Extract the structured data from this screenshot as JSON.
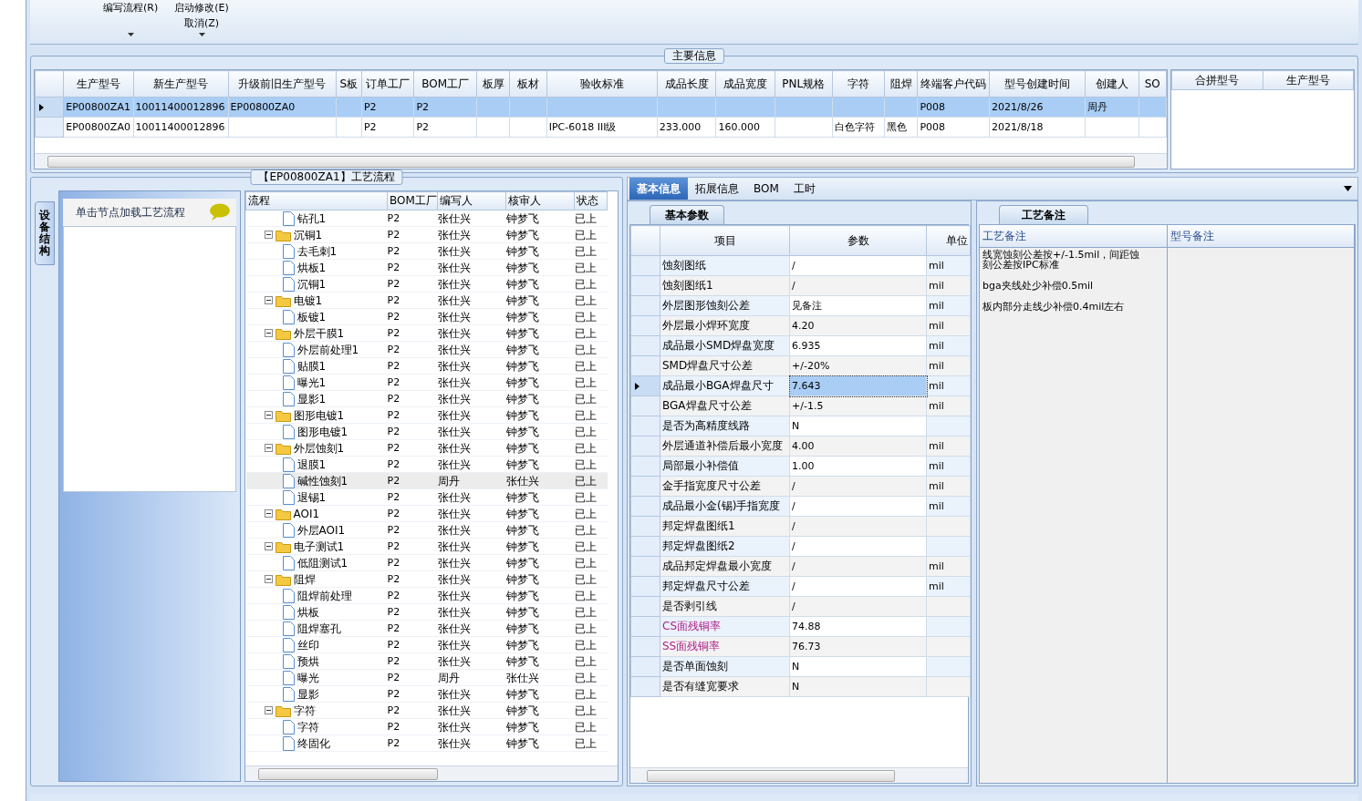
{
  "ribbon": {
    "commands": [
      {
        "label": "编写流程(R)"
      },
      {
        "label": "启动修改(E)"
      },
      {
        "label": "取消(Z)"
      }
    ]
  },
  "main_info": {
    "title": "主要信息",
    "columns": [
      "生产型号",
      "新生产型号",
      "升级前旧生产型号",
      "S板",
      "订单工厂",
      "BOM工厂",
      "板厚",
      "板材",
      "验收标准",
      "成品长度",
      "成品宽度",
      "PNL规格",
      "字符",
      "阻焊",
      "终端客户代码",
      "型号创建时间",
      "创建人",
      "SO"
    ],
    "rows": [
      {
        "selected": true,
        "cells": [
          "EP00800ZA1",
          "10011400012896",
          "EP00800ZA0",
          null,
          "P2",
          "P2",
          null,
          null,
          null,
          null,
          null,
          null,
          null,
          null,
          "P008",
          "2021/8/26",
          "周丹",
          null
        ]
      },
      {
        "selected": false,
        "cells": [
          "EP00800ZA0",
          "10011400012896",
          null,
          null,
          "P2",
          "P2",
          null,
          null,
          "IPC-6018 III级",
          "233.000",
          "160.000",
          null,
          "白色字符",
          "黑色",
          "P008",
          "2021/8/18",
          null,
          null
        ]
      }
    ],
    "side_columns": [
      "合拼型号",
      "生产型号"
    ]
  },
  "process": {
    "title": "【EP00800ZA1】工艺流程",
    "side_tab": "设备结构",
    "hint": "单击节点加载工艺流程",
    "columns": [
      "流程",
      "BOM工厂",
      "编写人",
      "核审人",
      "状态"
    ],
    "tree": [
      {
        "kind": "leaf",
        "name": "钻孔1",
        "bom": "P2",
        "writer": "张仕兴",
        "reviewer": "钟梦飞",
        "status": "已上",
        "selected": false
      },
      {
        "kind": "folder",
        "name": "沉铜1",
        "bom": "P2",
        "writer": "张仕兴",
        "reviewer": "钟梦飞",
        "status": "已上",
        "selected": false,
        "expanded": true,
        "children": [
          {
            "kind": "leaf",
            "name": "去毛刺1",
            "bom": "P2",
            "writer": "张仕兴",
            "reviewer": "钟梦飞",
            "status": "已上",
            "selected": false
          },
          {
            "kind": "leaf",
            "name": "烘板1",
            "bom": "P2",
            "writer": "张仕兴",
            "reviewer": "钟梦飞",
            "status": "已上",
            "selected": false
          },
          {
            "kind": "leaf",
            "name": "沉铜1",
            "bom": "P2",
            "writer": "张仕兴",
            "reviewer": "钟梦飞",
            "status": "已上",
            "selected": false
          }
        ]
      },
      {
        "kind": "folder",
        "name": "电镀1",
        "bom": "P2",
        "writer": "张仕兴",
        "reviewer": "钟梦飞",
        "status": "已上",
        "selected": false,
        "expanded": true,
        "children": [
          {
            "kind": "leaf",
            "name": "板镀1",
            "bom": "P2",
            "writer": "张仕兴",
            "reviewer": "钟梦飞",
            "status": "已上",
            "selected": false
          }
        ]
      },
      {
        "kind": "folder",
        "name": "外层干膜1",
        "bom": "P2",
        "writer": "张仕兴",
        "reviewer": "钟梦飞",
        "status": "已上",
        "selected": false,
        "expanded": true,
        "children": [
          {
            "kind": "leaf",
            "name": "外层前处理1",
            "bom": "P2",
            "writer": "张仕兴",
            "reviewer": "钟梦飞",
            "status": "已上",
            "selected": false
          },
          {
            "kind": "leaf",
            "name": "贴膜1",
            "bom": "P2",
            "writer": "张仕兴",
            "reviewer": "钟梦飞",
            "status": "已上",
            "selected": false
          },
          {
            "kind": "leaf",
            "name": "曝光1",
            "bom": "P2",
            "writer": "张仕兴",
            "reviewer": "钟梦飞",
            "status": "已上",
            "selected": false
          },
          {
            "kind": "leaf",
            "name": "显影1",
            "bom": "P2",
            "writer": "张仕兴",
            "reviewer": "钟梦飞",
            "status": "已上",
            "selected": false
          }
        ]
      },
      {
        "kind": "folder",
        "name": "图形电镀1",
        "bom": "P2",
        "writer": "张仕兴",
        "reviewer": "钟梦飞",
        "status": "已上",
        "selected": false,
        "expanded": true,
        "children": [
          {
            "kind": "leaf",
            "name": "图形电镀1",
            "bom": "P2",
            "writer": "张仕兴",
            "reviewer": "钟梦飞",
            "status": "已上",
            "selected": false
          }
        ]
      },
      {
        "kind": "folder",
        "name": "外层蚀刻1",
        "bom": "P2",
        "writer": "张仕兴",
        "reviewer": "钟梦飞",
        "status": "已上",
        "selected": false,
        "expanded": true,
        "children": [
          {
            "kind": "leaf",
            "name": "退膜1",
            "bom": "P2",
            "writer": "张仕兴",
            "reviewer": "钟梦飞",
            "status": "已上",
            "selected": false
          },
          {
            "kind": "leaf",
            "name": "碱性蚀刻1",
            "bom": "P2",
            "writer": "周丹",
            "reviewer": "张仕兴",
            "status": "已上",
            "selected": true
          },
          {
            "kind": "leaf",
            "name": "退锡1",
            "bom": "P2",
            "writer": "张仕兴",
            "reviewer": "钟梦飞",
            "status": "已上",
            "selected": false
          }
        ]
      },
      {
        "kind": "folder",
        "name": "AOI1",
        "bom": "P2",
        "writer": "张仕兴",
        "reviewer": "钟梦飞",
        "status": "已上",
        "selected": false,
        "expanded": true,
        "children": [
          {
            "kind": "leaf",
            "name": "外层AOI1",
            "bom": "P2",
            "writer": "张仕兴",
            "reviewer": "钟梦飞",
            "status": "已上",
            "selected": false
          }
        ]
      },
      {
        "kind": "folder",
        "name": "电子测试1",
        "bom": "P2",
        "writer": "张仕兴",
        "reviewer": "钟梦飞",
        "status": "已上",
        "selected": false,
        "expanded": true,
        "children": [
          {
            "kind": "leaf",
            "name": "低阻测试1",
            "bom": "P2",
            "writer": "张仕兴",
            "reviewer": "钟梦飞",
            "status": "已上",
            "selected": false
          }
        ]
      },
      {
        "kind": "folder",
        "name": "阻焊",
        "bom": "P2",
        "writer": "张仕兴",
        "reviewer": "钟梦飞",
        "status": "已上",
        "selected": false,
        "expanded": true,
        "children": [
          {
            "kind": "leaf",
            "name": "阻焊前处理",
            "bom": "P2",
            "writer": "张仕兴",
            "reviewer": "钟梦飞",
            "status": "已上",
            "selected": false
          },
          {
            "kind": "leaf",
            "name": "烘板",
            "bom": "P2",
            "writer": "张仕兴",
            "reviewer": "钟梦飞",
            "status": "已上",
            "selected": false
          },
          {
            "kind": "leaf",
            "name": "阻焊塞孔",
            "bom": "P2",
            "writer": "张仕兴",
            "reviewer": "钟梦飞",
            "status": "已上",
            "selected": false
          },
          {
            "kind": "leaf",
            "name": "丝印",
            "bom": "P2",
            "writer": "张仕兴",
            "reviewer": "钟梦飞",
            "status": "已上",
            "selected": false
          },
          {
            "kind": "leaf",
            "name": "预烘",
            "bom": "P2",
            "writer": "张仕兴",
            "reviewer": "钟梦飞",
            "status": "已上",
            "selected": false
          },
          {
            "kind": "leaf",
            "name": "曝光",
            "bom": "P2",
            "writer": "周丹",
            "reviewer": "张仕兴",
            "status": "已上",
            "selected": false
          },
          {
            "kind": "leaf",
            "name": "显影",
            "bom": "P2",
            "writer": "张仕兴",
            "reviewer": "钟梦飞",
            "status": "已上",
            "selected": false
          }
        ]
      },
      {
        "kind": "folder",
        "name": "字符",
        "bom": "P2",
        "writer": "张仕兴",
        "reviewer": "钟梦飞",
        "status": "已上",
        "selected": false,
        "expanded": true,
        "children": [
          {
            "kind": "leaf",
            "name": "字符",
            "bom": "P2",
            "writer": "张仕兴",
            "reviewer": "钟梦飞",
            "status": "已上",
            "selected": false
          },
          {
            "kind": "leaf",
            "name": "终固化",
            "bom": "P2",
            "writer": "张仕兴",
            "reviewer": "钟梦飞",
            "status": "已上",
            "selected": false
          }
        ]
      }
    ]
  },
  "tabs": [
    {
      "label": "基本信息",
      "selected": true
    },
    {
      "label": "拓展信息",
      "selected": false
    },
    {
      "label": "BOM",
      "selected": false
    },
    {
      "label": "工时",
      "selected": false
    }
  ],
  "params": {
    "tab": "基本参数",
    "columns": [
      "项目",
      "参数",
      "单位"
    ],
    "rows": [
      {
        "item": "蚀刻图纸",
        "value": "/",
        "unit": "mil",
        "selected": false
      },
      {
        "item": "蚀刻图纸1",
        "value": "/",
        "unit": "mil",
        "selected": false
      },
      {
        "item": "外层图形蚀刻公差",
        "value": "见备注",
        "unit": "mil",
        "selected": false
      },
      {
        "item": "外层最小焊环宽度",
        "value": "4.20",
        "unit": "mil",
        "selected": false
      },
      {
        "item": "成品最小SMD焊盘宽度",
        "value": "6.935",
        "unit": "mil",
        "selected": false
      },
      {
        "item": "SMD焊盘尺寸公差",
        "value": "+/-20%",
        "unit": "mil",
        "selected": false
      },
      {
        "item": "成品最小BGA焊盘尺寸",
        "value": "7.643",
        "unit": "mil",
        "selected": true
      },
      {
        "item": "BGA焊盘尺寸公差",
        "value": "+/-1.5",
        "unit": "mil",
        "selected": false
      },
      {
        "item": "是否为高精度线路",
        "value": "N",
        "selected": false
      },
      {
        "item": "外层通道补偿后最小宽度",
        "value": "4.00",
        "unit": "mil",
        "selected": false
      },
      {
        "item": "局部最小补偿值",
        "value": "1.00",
        "unit": "mil",
        "selected": false
      },
      {
        "item": "金手指宽度尺寸公差",
        "value": "/",
        "unit": "mil",
        "selected": false
      },
      {
        "item": "成品最小金(锡)手指宽度",
        "value": "/",
        "unit": "mil",
        "selected": false
      },
      {
        "item": "邦定焊盘图纸1",
        "value": "/",
        "selected": false
      },
      {
        "item": "邦定焊盘图纸2",
        "value": "/",
        "selected": false
      },
      {
        "item": "成品邦定焊盘最小宽度",
        "value": "/",
        "unit": "mil",
        "selected": false
      },
      {
        "item": "邦定焊盘尺寸公差",
        "value": "/",
        "unit": "mil",
        "selected": false
      },
      {
        "item": "是否剥引线",
        "value": "/",
        "selected": false
      },
      {
        "item": "CS面残铜率",
        "value": "74.88",
        "color": "#b0208a",
        "selected": false
      },
      {
        "item": "SS面残铜率",
        "value": "76.73",
        "color": "#b0208a",
        "selected": false
      },
      {
        "item": "是否单面蚀刻",
        "value": "N",
        "selected": false
      },
      {
        "item": "是否有缝宽要求",
        "value": "N",
        "selected": false
      }
    ]
  },
  "notes": {
    "tab": "工艺备注",
    "columns": [
      "工艺备注",
      "型号备注"
    ],
    "process_notes": [
      "线宽蚀刻公差按+/-1.5mil，间距蚀刻公差按IPC标准",
      "bga夹线处少补偿0.5mil",
      "板内部分走线少补偿0.4mil左右"
    ]
  }
}
